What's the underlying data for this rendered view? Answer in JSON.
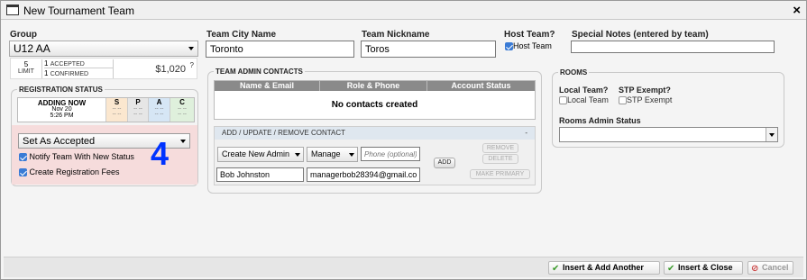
{
  "window": {
    "title": "New Tournament Team",
    "close": "×"
  },
  "group": {
    "label": "Group",
    "value": "U12 AA",
    "limit_count": "5",
    "limit_label": "LIMIT",
    "accepted_count": "1",
    "accepted_label": "ACCEPTED",
    "confirmed_count": "1",
    "confirmed_label": "CONFIRMED",
    "fee": "$1,020",
    "help": "?"
  },
  "registration": {
    "legend": "REGISTRATION STATUS",
    "adding_now": "ADDING NOW",
    "date": "Nov 20",
    "time": "5:26 PM",
    "columns": [
      "S",
      "P",
      "A",
      "C"
    ],
    "dash": "-- --",
    "status_select": "Set As Accepted",
    "notify_label": "Notify Team With New Status",
    "fees_label": "Create Registration Fees",
    "step_number": "4"
  },
  "team": {
    "city_label": "Team City Name",
    "city_value": "Toronto",
    "nickname_label": "Team Nickname",
    "nickname_value": "Toros",
    "host_label": "Host Team?",
    "host_check_label": "Host Team",
    "notes_label": "Special Notes (entered by team)",
    "notes_value": ""
  },
  "contacts": {
    "legend": "TEAM ADMIN CONTACTS",
    "headers": [
      "Name & Email",
      "Role & Phone",
      "Account Status"
    ],
    "empty_text": "No contacts created",
    "panel_title": "ADD / UPDATE / REMOVE CONTACT",
    "collapse": "-",
    "admin_select": "Create New Admin",
    "role_select": "Manage",
    "phone_placeholder": "Phone (optional)",
    "name_value": "Bob Johnston",
    "email_value": "managerbob28394@gmail.com",
    "add_btn": "ADD",
    "remove_btn": "REMOVE",
    "delete_btn": "DELETE",
    "primary_btn": "MAKE PRIMARY"
  },
  "rooms": {
    "legend": "ROOMS",
    "local_label": "Local Team?",
    "local_check": "Local Team",
    "stp_label": "STP Exempt?",
    "stp_check": "STP Exempt",
    "admin_status_label": "Rooms Admin Status",
    "admin_status_value": ""
  },
  "footer": {
    "insert_add": "Insert & Add Another",
    "insert_close": "Insert & Close",
    "cancel": "Cancel"
  },
  "colors": {
    "accent_blue": "#0033ff",
    "pink_panel": "#f6dcdc",
    "s_col": "#fbe7cf",
    "p_col": "#e6e6e6",
    "a_col": "#d6e6f5",
    "c_col": "#dff0dc"
  }
}
